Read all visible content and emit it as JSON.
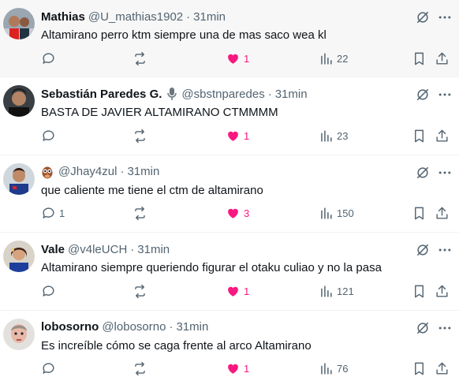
{
  "colors": {
    "like_active": "#f91880",
    "secondary_text": "#536471",
    "primary_text": "#0f1419",
    "divider": "#eff3f4"
  },
  "icons": {
    "reply": "speech-bubble",
    "retweet": "repost-arrows",
    "like": "heart-filled",
    "views": "bar-chart",
    "bookmark": "bookmark",
    "share": "upload-arrow",
    "grok": "circle-slash",
    "more": "horizontal-ellipsis"
  },
  "tweets": [
    {
      "name": "Mathias",
      "handle": "@U_mathias1902",
      "sep": "·",
      "time": "31min",
      "text": "Altamirano perro ktm siempre una de mas saco wea kl",
      "replies": "",
      "retweets": "",
      "likes": "1",
      "views": "22"
    },
    {
      "name": "Sebastián Paredes G.",
      "handle": "@sbstnparedes",
      "sep": "·",
      "time": "31min",
      "text": "BASTA DE JAVIER ALTAMIRANO CTMMMM",
      "replies": "",
      "retweets": "",
      "likes": "1",
      "views": "23"
    },
    {
      "name": "",
      "handle": "@Jhay4zul",
      "sep": "·",
      "time": "31min",
      "text": "que caliente me tiene el ctm de altamirano",
      "replies": "1",
      "retweets": "",
      "likes": "3",
      "views": "150"
    },
    {
      "name": "Vale",
      "handle": "@v4leUCH",
      "sep": "·",
      "time": "31min",
      "text": "Altamirano siempre queriendo figurar el otaku culiao y no la pasa",
      "replies": "",
      "retweets": "",
      "likes": "1",
      "views": "121"
    },
    {
      "name": "lobosorno",
      "handle": "@lobosorno",
      "sep": "·",
      "time": "31min",
      "text": "Es increíble cómo se caga frente al arco Altamirano",
      "replies": "",
      "retweets": "",
      "likes": "1",
      "views": "76"
    }
  ]
}
